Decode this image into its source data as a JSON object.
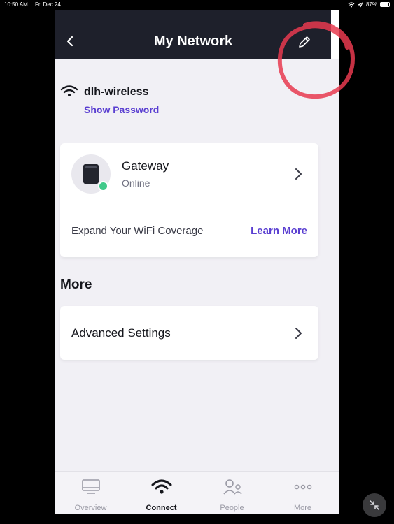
{
  "status_bar": {
    "time": "10:50 AM",
    "date": "Fri Dec 24",
    "battery": "87%"
  },
  "header": {
    "title": "My Network",
    "back_icon": "chevron-left-icon",
    "edit_icon": "pencil-icon"
  },
  "network": {
    "ssid": "dlh-wireless",
    "show_password_label": "Show Password"
  },
  "gateway_card": {
    "name": "Gateway",
    "status": "Online",
    "status_color": "#41c98a",
    "expand_text": "Expand Your WiFi Coverage",
    "learn_more_label": "Learn More"
  },
  "more": {
    "heading": "More",
    "advanced_settings_label": "Advanced Settings"
  },
  "tabs": [
    {
      "label": "Overview",
      "icon": "monitor-icon",
      "active": false
    },
    {
      "label": "Connect",
      "icon": "wifi-icon",
      "active": true
    },
    {
      "label": "People",
      "icon": "people-icon",
      "active": false
    },
    {
      "label": "More",
      "icon": "ellipsis-icon",
      "active": false
    }
  ],
  "colors": {
    "accent": "#5a3fd1",
    "header_bg": "#1e202b",
    "annotation": "#e8394f"
  }
}
